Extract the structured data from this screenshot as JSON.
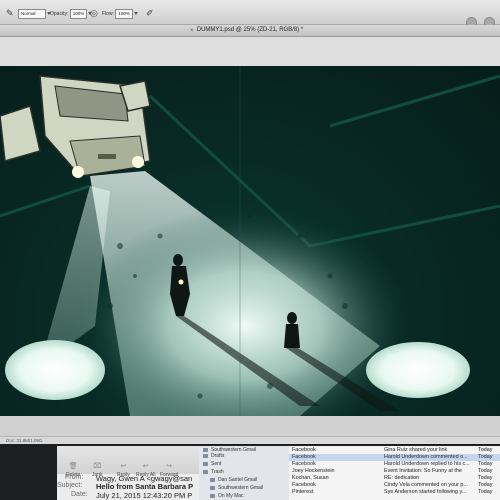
{
  "options_bar": {
    "mode_value": "Normal",
    "opacity_label": "Opacity:",
    "opacity_value": "100%",
    "flow_label": "Flow:",
    "flow_value": "100%"
  },
  "document": {
    "tab_title": "DUMMY1.psd @ 25% (ZD-21, RGB/8) *"
  },
  "statusbar": {
    "doc_info": "Doc: 31.8M/1.05G"
  },
  "mail": {
    "toolbar": [
      {
        "label": "Delete",
        "icon": "trash-icon"
      },
      {
        "label": "Junk",
        "icon": "junk-icon"
      },
      {
        "label": "Reply",
        "icon": "reply-icon"
      },
      {
        "label": "Reply All",
        "icon": "reply-all-icon"
      },
      {
        "label": "Forward",
        "icon": "forward-icon"
      }
    ],
    "header": {
      "from_label": "From:",
      "from_value": "Wagy, Gwen A <gwagy@san",
      "subject_label": "Subject:",
      "subject_value": "Hello from Santa Barbara P",
      "date_label": "Date:",
      "date_value": "July 21, 2015 12:43:20 PM P"
    },
    "mailboxes": [
      {
        "label": "Southwestern Gmail"
      },
      {
        "label": "Drafts"
      },
      {
        "label": "Sent"
      },
      {
        "label": "Trash"
      },
      {
        "label": "Dan Santel Gmail"
      },
      {
        "label": "Southwestern Gmail"
      },
      {
        "label": "On My Mac"
      }
    ],
    "messages": [
      {
        "from": "Facebook",
        "subject": "Gina Ruiz shared your link",
        "date": "Today"
      },
      {
        "from": "Facebook",
        "subject": "Harold Underdown commented o...",
        "date": "Today"
      },
      {
        "from": "Facebook",
        "subject": "Harold Underdown replied to his c...",
        "date": "Today"
      },
      {
        "from": "Joey Hockenstein",
        "subject": "Event Invitation: So Funny at the",
        "date": "Today"
      },
      {
        "from": "Kochan, Susan",
        "subject": "RE: dedication",
        "date": "Today"
      },
      {
        "from": "Facebook",
        "subject": "Cindy Vela commented on your p...",
        "date": "Today"
      },
      {
        "from": "Pinterest",
        "subject": "Sye Anderson started following y...",
        "date": "Today"
      }
    ]
  },
  "colors": {
    "art_background": "#082a25",
    "light_beam": "#dff3ea",
    "selection": "#c6d5ef"
  }
}
